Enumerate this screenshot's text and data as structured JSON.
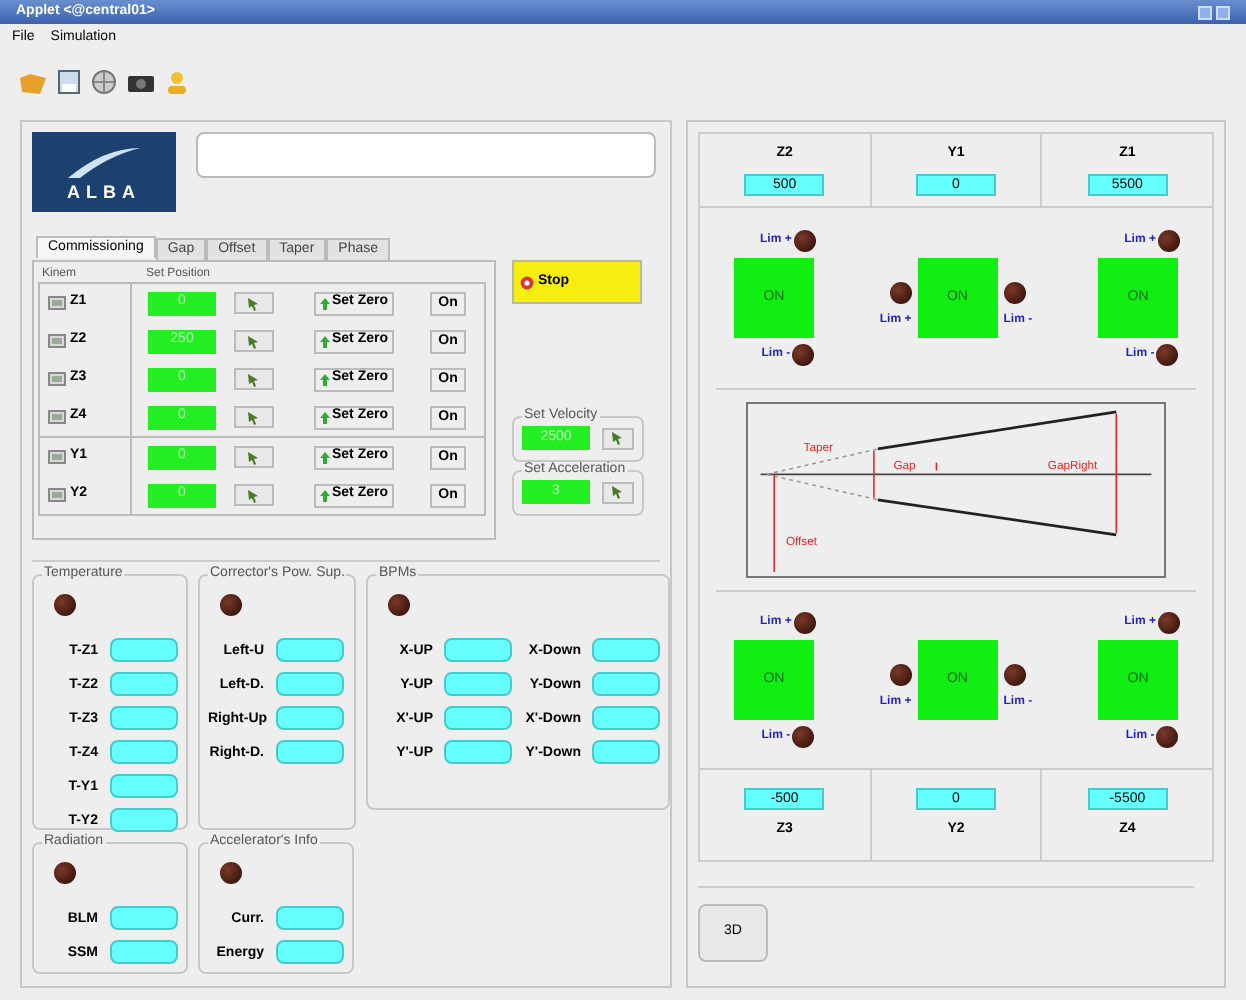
{
  "window": {
    "title": "Applet <@central01>"
  },
  "menu": [
    "File",
    "Simulation"
  ],
  "logo": {
    "text": "ALBA"
  },
  "tabs": [
    {
      "label": "Commissioning",
      "selected": true
    },
    {
      "label": "Gap",
      "selected": false
    },
    {
      "label": "Offset",
      "selected": false
    },
    {
      "label": "Taper",
      "selected": false
    },
    {
      "label": "Phase",
      "selected": false
    }
  ],
  "kinem": {
    "title": "Kinem",
    "set_position_title": "Set Position",
    "groups": [
      [
        {
          "label": "Z1",
          "value": "0",
          "zero": "Set Zero",
          "on": "On"
        },
        {
          "label": "Z2",
          "value": "250",
          "zero": "Set Zero",
          "on": "On"
        },
        {
          "label": "Z3",
          "value": "0",
          "zero": "Set Zero",
          "on": "On"
        },
        {
          "label": "Z4",
          "value": "0",
          "zero": "Set Zero",
          "on": "On"
        }
      ],
      [
        {
          "label": "Y1",
          "value": "0",
          "zero": "Set Zero",
          "on": "On"
        },
        {
          "label": "Y2",
          "value": "0",
          "zero": "Set Zero",
          "on": "On"
        }
      ]
    ]
  },
  "stop_button": "Stop",
  "velocity": {
    "title": "Set Velocity",
    "value": "2500"
  },
  "acceleration": {
    "title": "Set Acceleration",
    "value": "3"
  },
  "readouts": [
    {
      "title": "Temperature",
      "columns": [
        [
          "T-Z1",
          "T-Z2",
          "T-Z3",
          "T-Z4",
          "T-Y1",
          "T-Y2"
        ]
      ]
    },
    {
      "title": "Corrector's Pow. Sup.",
      "columns": [
        [
          "Left-U",
          "Left-D.",
          "Right-Up",
          "Right-D."
        ]
      ]
    },
    {
      "title": "BPMs",
      "columns": [
        [
          "X-UP",
          "Y-UP",
          "X'-UP",
          "Y'-UP"
        ],
        [
          "X-Down",
          "Y-Down",
          "X'-Down",
          "Y'-Down"
        ]
      ]
    }
  ],
  "readouts_lower": [
    {
      "title": "Radiation",
      "columns": [
        [
          "BLM",
          "SSM"
        ]
      ]
    },
    {
      "title": "Accelerator's Info",
      "columns": [
        [
          "Curr.",
          "Energy"
        ]
      ]
    }
  ],
  "top_axes": [
    {
      "label": "Z2",
      "value": "500"
    },
    {
      "label": "Y1",
      "value": "0"
    },
    {
      "label": "Z1",
      "value": "5500"
    }
  ],
  "top_motors": [
    {
      "kind": "vertical",
      "lim_plus": "Lim +",
      "state": "ON",
      "on": true,
      "lim_minus": "Lim -"
    },
    {
      "kind": "horizontal",
      "lim_plus": "Lim +",
      "state": "ON",
      "on": true,
      "lim_minus": "Lim -"
    },
    {
      "kind": "vertical",
      "lim_plus": "Lim +",
      "state": "ON",
      "on": true,
      "lim_minus": "Lim -"
    }
  ],
  "diagram": {
    "taper": "Taper",
    "gap": "Gap",
    "gap_right": "GapRight",
    "offset": "Offset"
  },
  "bottom_motors": [
    {
      "kind": "vertical",
      "lim_plus": "Lim +",
      "state": "ON",
      "on": true,
      "lim_minus": "Lim -"
    },
    {
      "kind": "horizontal",
      "lim_plus": "Lim +",
      "state": "ON",
      "on": true,
      "lim_minus": "Lim -"
    },
    {
      "kind": "vertical",
      "lim_plus": "Lim +",
      "state": "ON",
      "on": true,
      "lim_minus": "Lim -"
    }
  ],
  "bottom_axes": [
    {
      "label": "Z3",
      "value": "-500"
    },
    {
      "label": "Y2",
      "value": "0"
    },
    {
      "label": "Z4",
      "value": "-5500"
    }
  ],
  "button_3d": "3D"
}
